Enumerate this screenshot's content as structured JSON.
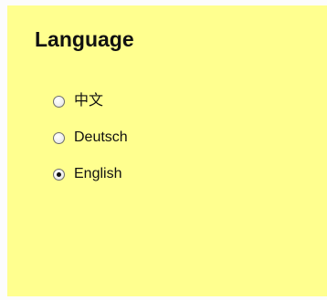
{
  "panel": {
    "background": "#ffff8f",
    "title": "Language"
  },
  "options": [
    {
      "label": "中文",
      "checked": false
    },
    {
      "label": "Deutsch",
      "checked": false
    },
    {
      "label": "English",
      "checked": true
    }
  ]
}
